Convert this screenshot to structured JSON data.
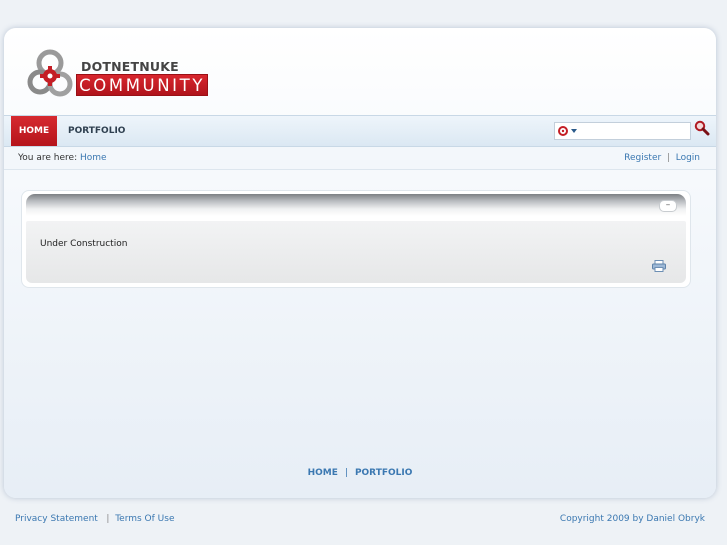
{
  "logo": {
    "line1": "DOTNETNUKE",
    "line2": "COMMUNITY"
  },
  "nav": {
    "items": [
      {
        "label": "HOME",
        "active": true
      },
      {
        "label": "PORTFOLIO",
        "active": false
      }
    ]
  },
  "search": {
    "value": "",
    "icon": "magnifier-icon",
    "engine_icon": "dnn-gear-icon"
  },
  "breadcrumb": {
    "prefix": "You are here:",
    "current": "Home"
  },
  "user": {
    "register": "Register",
    "separator": "|",
    "login": "Login"
  },
  "module": {
    "minimize": "–",
    "content": "Under Construction",
    "print_icon": "print-icon"
  },
  "footer_nav": {
    "home": "HOME",
    "separator": "|",
    "portfolio": "PORTFOLIO"
  },
  "bottom": {
    "privacy": "Privacy Statement",
    "separator": "|",
    "terms": "Terms Of Use",
    "copyright": "Copyright 2009 by Daniel Obryk"
  },
  "colors": {
    "brand_red": "#c41e25",
    "link_blue": "#3b78b1"
  }
}
